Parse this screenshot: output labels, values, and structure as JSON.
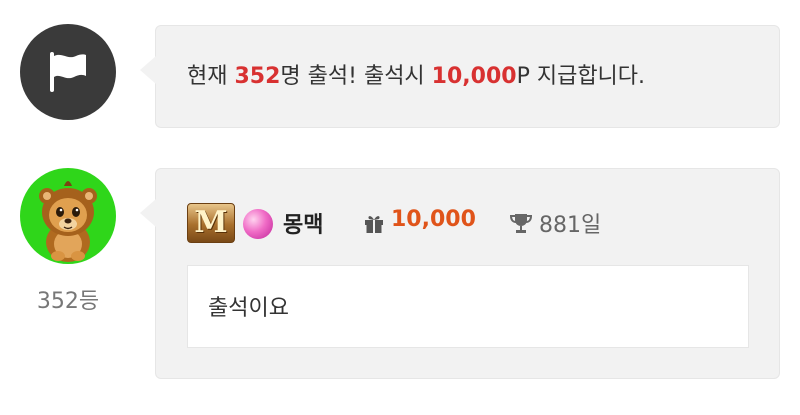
{
  "notice": {
    "text_prefix": "현재 ",
    "attendee_count": "352",
    "text_middle": "명 출석! 출석시 ",
    "reward_points": "10,000",
    "text_suffix": "P 지급합니다."
  },
  "post": {
    "rank": "352등",
    "badge_letter": "M",
    "nickname": "몽맥",
    "points": "10,000",
    "days": "881일",
    "comment": "출석이요"
  },
  "icons": {
    "notice_avatar": "flag-icon",
    "user_avatar": "lion-cub-avatar",
    "points": "gift-icon",
    "days": "trophy-icon"
  },
  "colors": {
    "highlight_red": "#d83131",
    "points_orange": "#e0541a",
    "avatar_green": "#2fd61a",
    "bubble_bg": "#f2f2f2"
  }
}
